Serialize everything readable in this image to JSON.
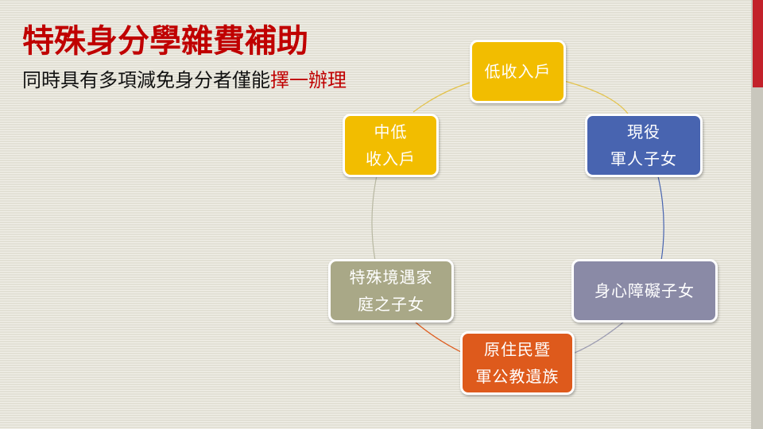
{
  "slide": {
    "title": "特殊身分學雜費補助",
    "subtitle_prefix": "同時具有多項減免身分者僅能",
    "subtitle_highlight": "擇一辦理"
  },
  "cycle_nodes": [
    {
      "lines": [
        "低收入戶"
      ],
      "color": "#f2bd00"
    },
    {
      "lines": [
        "現役",
        "軍人子女"
      ],
      "color": "#4864b0"
    },
    {
      "lines": [
        "身心障礙子女"
      ],
      "color": "#8a8aa6"
    },
    {
      "lines": [
        "原住民暨",
        "軍公教遺族"
      ],
      "color": "#de5a1c"
    },
    {
      "lines": [
        "特殊境遇家",
        "庭之子女"
      ],
      "color": "#a9a887"
    },
    {
      "lines": [
        "中低",
        "收入戶"
      ],
      "color": "#f2bd00"
    }
  ],
  "colors": {
    "title": "#c00000",
    "accent_bar": "#c2212a",
    "background": "#e9e7dc"
  }
}
